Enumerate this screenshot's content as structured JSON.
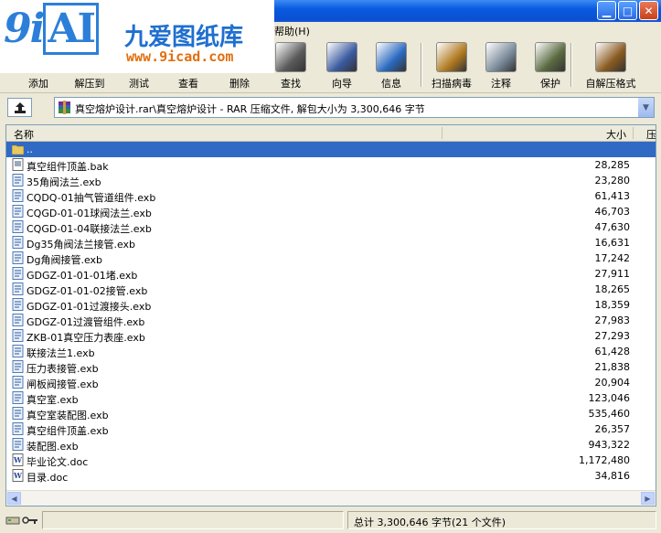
{
  "logo": {
    "cn": "九爱图纸库",
    "url": "www.9icad.com"
  },
  "menubar": {
    "visible_item": "帮助(H)"
  },
  "toolbar": {
    "buttons": [
      {
        "label": "添加",
        "icon": "add-icon",
        "color": "#6a8a3a"
      },
      {
        "label": "解压到",
        "icon": "extract-to-icon",
        "color": "#c08a20"
      },
      {
        "label": "测试",
        "icon": "test-icon",
        "color": "#5a8ac0"
      },
      {
        "label": "查看",
        "icon": "view-icon",
        "color": "#8090a0"
      },
      {
        "label": "删除",
        "icon": "delete-icon",
        "color": "#b03030"
      },
      {
        "label": "查找",
        "icon": "binoculars-icon",
        "color": "#5a5a5a"
      },
      {
        "label": "向导",
        "icon": "wizard-icon",
        "color": "#3a5aa0"
      },
      {
        "label": "信息",
        "icon": "info-icon",
        "color": "#2a6ac0"
      },
      {
        "label": "扫描病毒",
        "icon": "virus-scan-icon",
        "color": "#b07a20"
      },
      {
        "label": "注释",
        "icon": "comment-icon",
        "color": "#7a8a9a"
      },
      {
        "label": "保护",
        "icon": "shield-icon",
        "color": "#5a6a40"
      },
      {
        "label": "自解压格式",
        "icon": "sfx-icon",
        "color": "#8a5a20"
      }
    ]
  },
  "pathbar": {
    "path": "真空熔炉设计.rar\\真空熔炉设计 - RAR 压缩文件, 解包大小为 3,300,646 字节"
  },
  "list": {
    "headers": {
      "name": "名称",
      "size": "大小",
      "packed": "压"
    },
    "parent_row": "..",
    "files": [
      {
        "name": "真空组件顶盖.bak",
        "size": "28,285",
        "type": "bak"
      },
      {
        "name": "35角阀法兰.exb",
        "size": "23,280",
        "type": "exb"
      },
      {
        "name": "CQDQ-01抽气管道组件.exb",
        "size": "61,413",
        "type": "exb"
      },
      {
        "name": "CQGD-01-01球阀法兰.exb",
        "size": "46,703",
        "type": "exb"
      },
      {
        "name": "CQGD-01-04联接法兰.exb",
        "size": "47,630",
        "type": "exb"
      },
      {
        "name": "Dg35角阀法兰接管.exb",
        "size": "16,631",
        "type": "exb"
      },
      {
        "name": "Dg角阀接管.exb",
        "size": "17,242",
        "type": "exb"
      },
      {
        "name": "GDGZ-01-01-01堵.exb",
        "size": "27,911",
        "type": "exb"
      },
      {
        "name": "GDGZ-01-01-02接管.exb",
        "size": "18,265",
        "type": "exb"
      },
      {
        "name": "GDGZ-01-01过渡接头.exb",
        "size": "18,359",
        "type": "exb"
      },
      {
        "name": "GDGZ-01过渡管组件.exb",
        "size": "27,983",
        "type": "exb"
      },
      {
        "name": "ZKB-01真空压力表座.exb",
        "size": "27,293",
        "type": "exb"
      },
      {
        "name": "联接法兰1.exb",
        "size": "61,428",
        "type": "exb"
      },
      {
        "name": "压力表接管.exb",
        "size": "21,838",
        "type": "exb"
      },
      {
        "name": "闸板阀接管.exb",
        "size": "20,904",
        "type": "exb"
      },
      {
        "name": "真空室.exb",
        "size": "123,046",
        "type": "exb"
      },
      {
        "name": "真空室装配图.exb",
        "size": "535,460",
        "type": "exb"
      },
      {
        "name": "真空组件顶盖.exb",
        "size": "26,357",
        "type": "exb"
      },
      {
        "name": "装配图.exb",
        "size": "943,322",
        "type": "exb"
      },
      {
        "name": "毕业论文.doc",
        "size": "1,172,480",
        "type": "doc"
      },
      {
        "name": "目录.doc",
        "size": "34,816",
        "type": "doc"
      }
    ]
  },
  "statusbar": {
    "summary": "总计 3,300,646 字节(21 个文件)"
  },
  "colors": {
    "selection": "#316ac5",
    "titlebar": "#0a5ae0"
  }
}
